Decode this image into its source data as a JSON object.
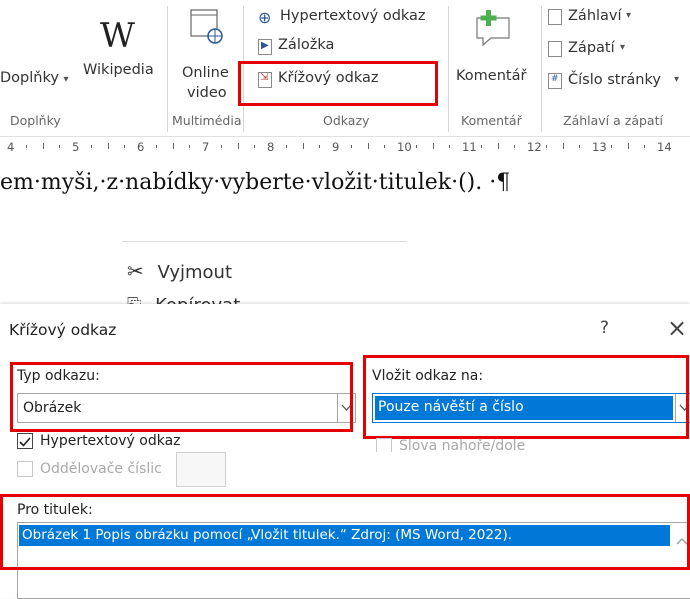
{
  "ribbon": {
    "addins": {
      "doplnky_label": "Doplňky",
      "wikipedia_label": "Wikipedia",
      "group_label": "Doplňky"
    },
    "media": {
      "online_video_line1": "Online",
      "online_video_line2": "video",
      "group_label": "Multimédia"
    },
    "links": {
      "hyperlink_label": "Hypertextový odkaz",
      "bookmark_label": "Záložka",
      "crossref_label": "Křížový odkaz",
      "group_label": "Odkazy"
    },
    "comment": {
      "label": "Komentář",
      "group_label": "Komentář"
    },
    "headerfooter": {
      "header_label": "Záhlaví",
      "footer_label": "Zápatí",
      "page_number_label": "Číslo stránky",
      "group_label": "Záhlaví a zápatí"
    }
  },
  "ruler": {
    "numbers": [
      "4",
      "5",
      "6",
      "7",
      "8",
      "9",
      "10",
      "11",
      "12",
      "13",
      "14"
    ]
  },
  "document": {
    "line": "em·myši,·z·nabídky·vyberte·vložit·titulek·(). ·¶"
  },
  "context_menu": {
    "items": [
      {
        "label": "Vyjmout",
        "icon": "scissors-icon"
      },
      {
        "label": "Kopírovat",
        "icon": "copy-icon"
      }
    ]
  },
  "dialog": {
    "title": "Křížový odkaz",
    "help": "?",
    "close": "×",
    "type_label": "Typ odkazu:",
    "type_value": "Obrázek",
    "insert_label": "Vložit odkaz na:",
    "insert_value": "Pouze návěští a číslo",
    "hyperlink_checkbox": "Hypertextový odkaz",
    "hyperlink_checked": true,
    "above_below_checkbox": "Slova nahoře/dole",
    "separator_checkbox": "Oddělovače číslic",
    "caption_label": "Pro titulek:",
    "caption_items": [
      "Obrázek 1 Popis obrázku pomocí „Vložit titulek.“ Zdroj: (MS Word, 2022)."
    ]
  },
  "colors": {
    "highlight": "#e60000",
    "selection": "#0078d7",
    "accent_green": "#4caf50"
  }
}
